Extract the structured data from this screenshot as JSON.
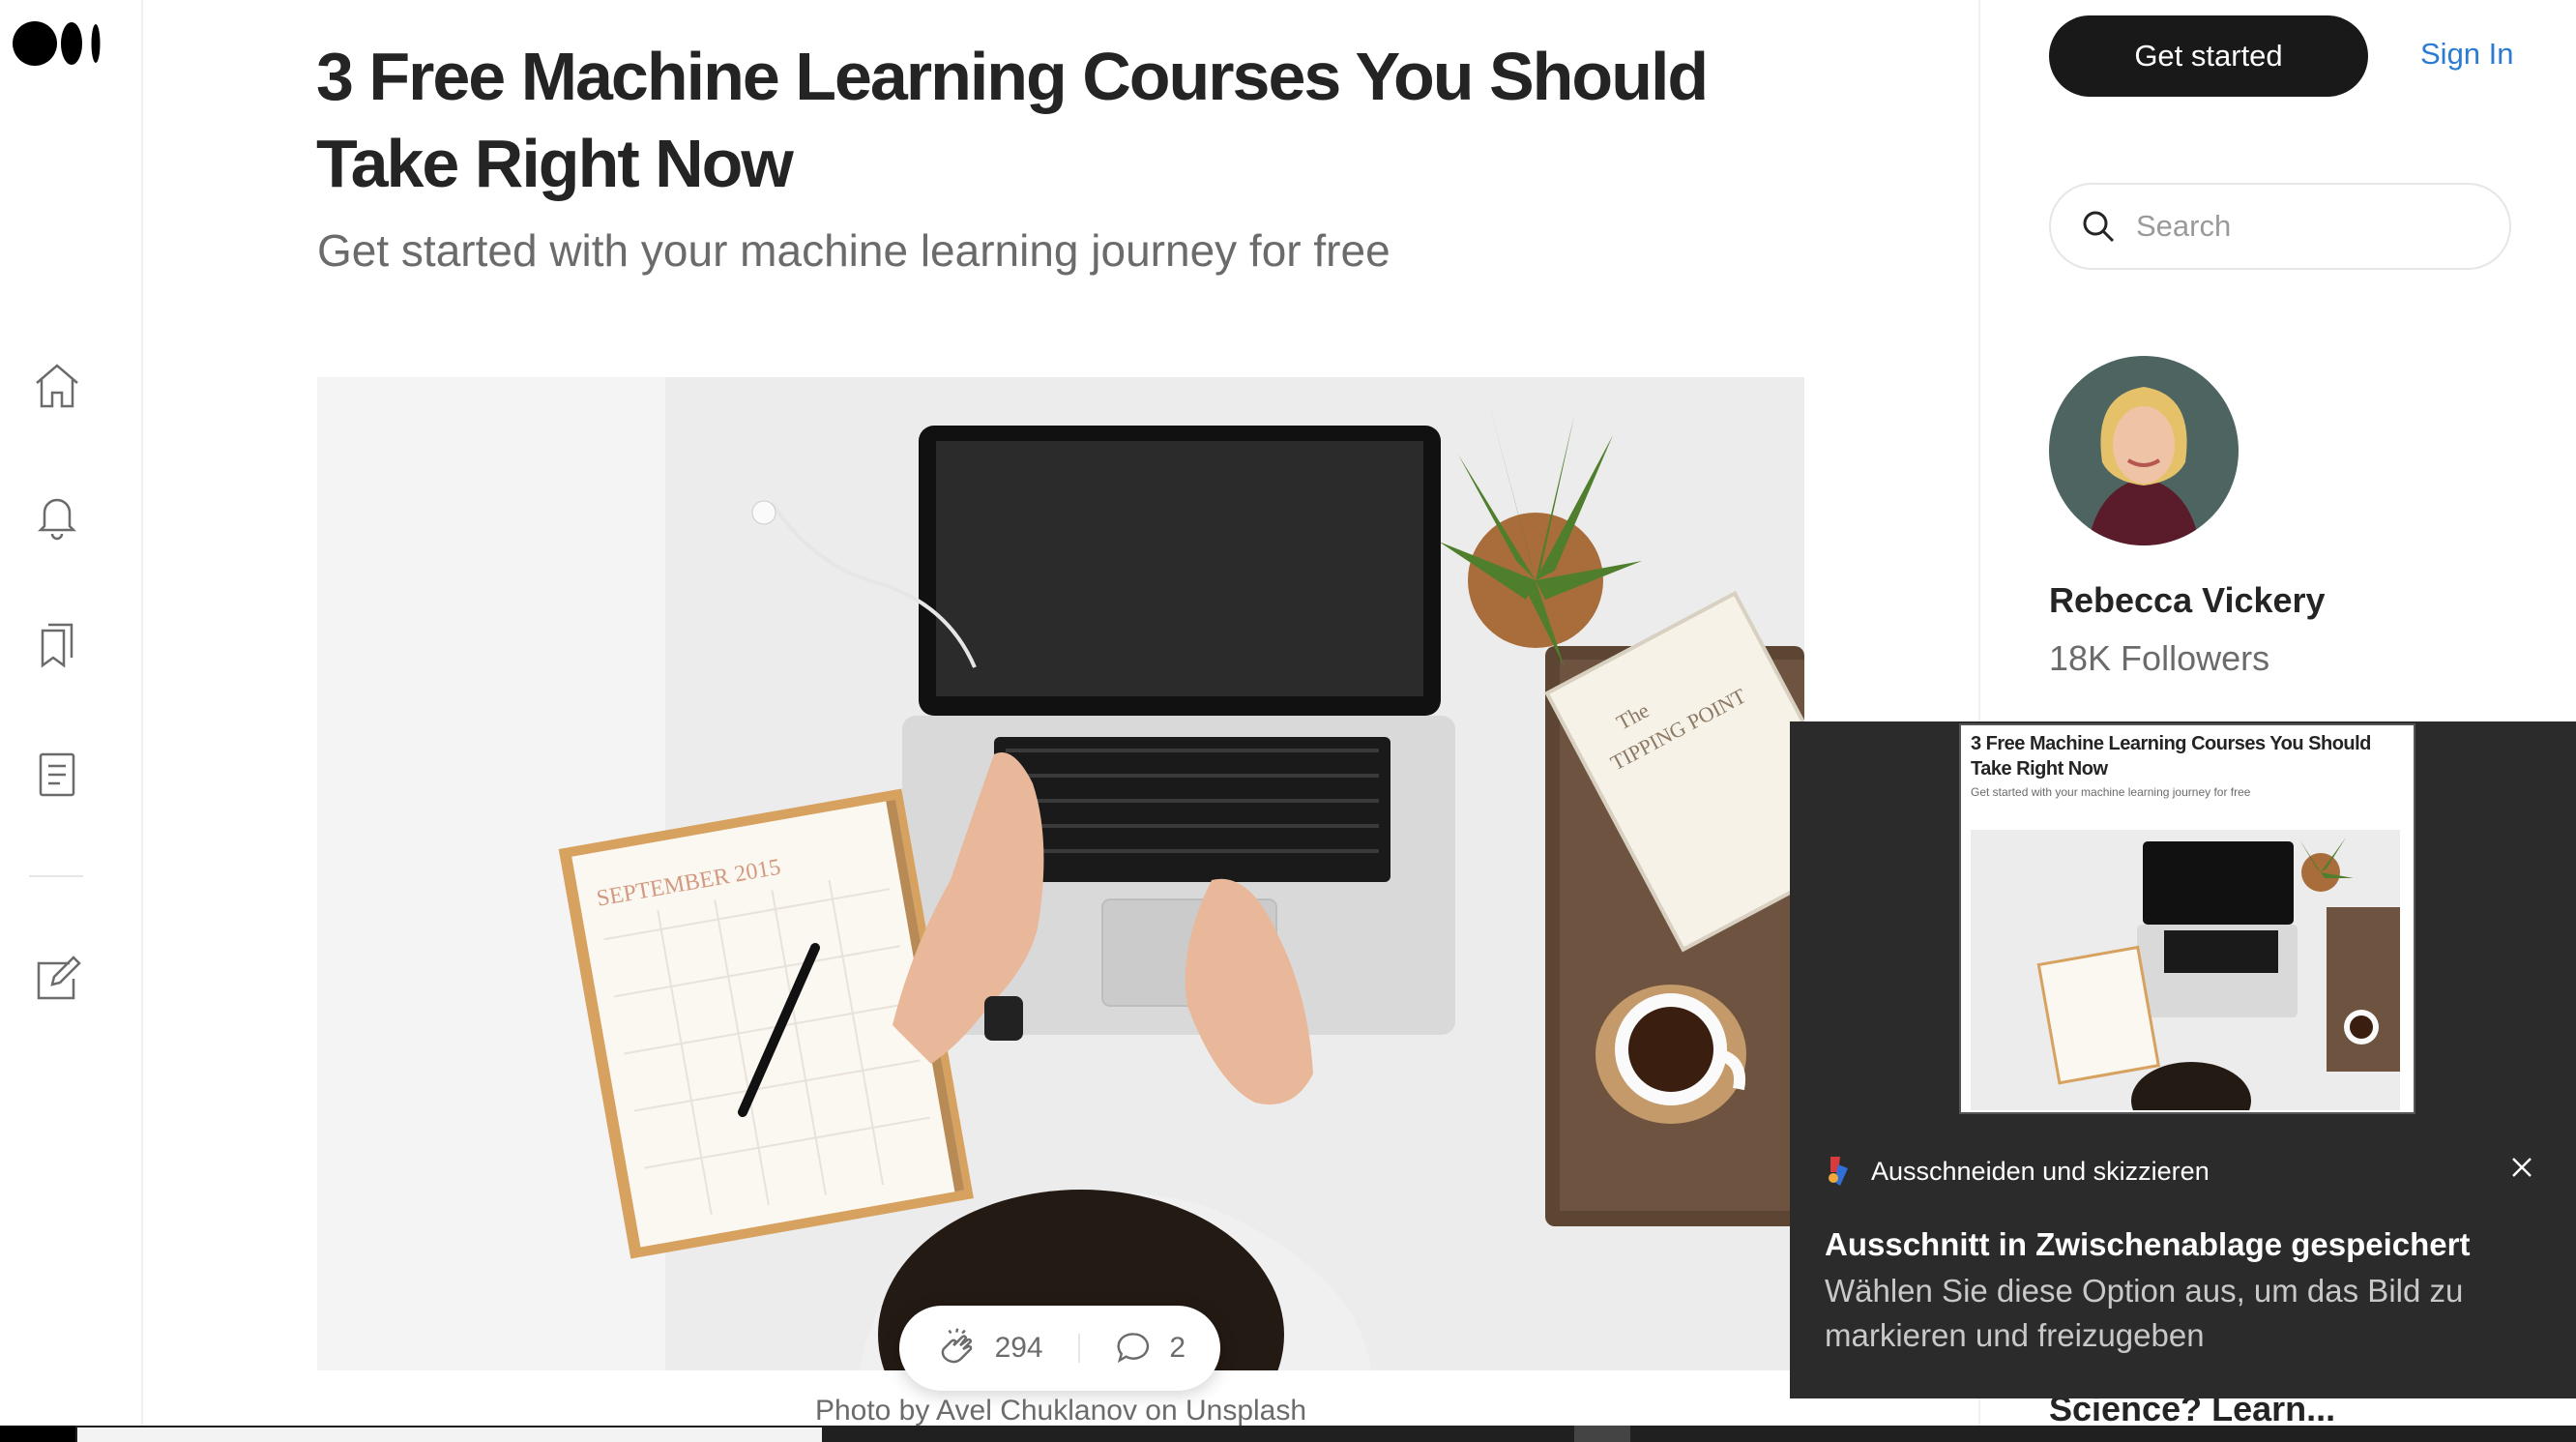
{
  "article": {
    "title": "3 Free Machine Learning Courses You Should Take Right Now",
    "subtitle": "Get started with your machine learning journey for free",
    "photo_caption": "Photo by Avel Chuklanov on Unsplash",
    "claps": "294",
    "responses": "2"
  },
  "nav": {
    "icons": [
      "logo-icon",
      "home-icon",
      "bell-icon",
      "bookmarks-icon",
      "stories-icon",
      "write-icon"
    ]
  },
  "header": {
    "get_started": "Get started",
    "sign_in": "Sign In",
    "search_placeholder": "Search"
  },
  "author": {
    "name": "Rebecca Vickery",
    "followers": "18K Followers"
  },
  "sidebar": {
    "partial_heading": "Science? Learn..."
  },
  "toast": {
    "app_name": "Ausschneiden und skizzieren",
    "heading": "Ausschnitt in Zwischenablage gespeichert",
    "body": "Wählen Sie diese Option aus, um das Bild zu markieren und freizugeben",
    "thumb_title": "3 Free Machine Learning Courses You Should Take Right Now",
    "thumb_subtitle": "Get started with your machine learning journey for free"
  },
  "colors": {
    "text": "#242424",
    "muted": "#6b6b6b",
    "button_dark": "#191919",
    "link_blue": "#2a7bd1",
    "toast_bg": "#2b2b2b"
  }
}
